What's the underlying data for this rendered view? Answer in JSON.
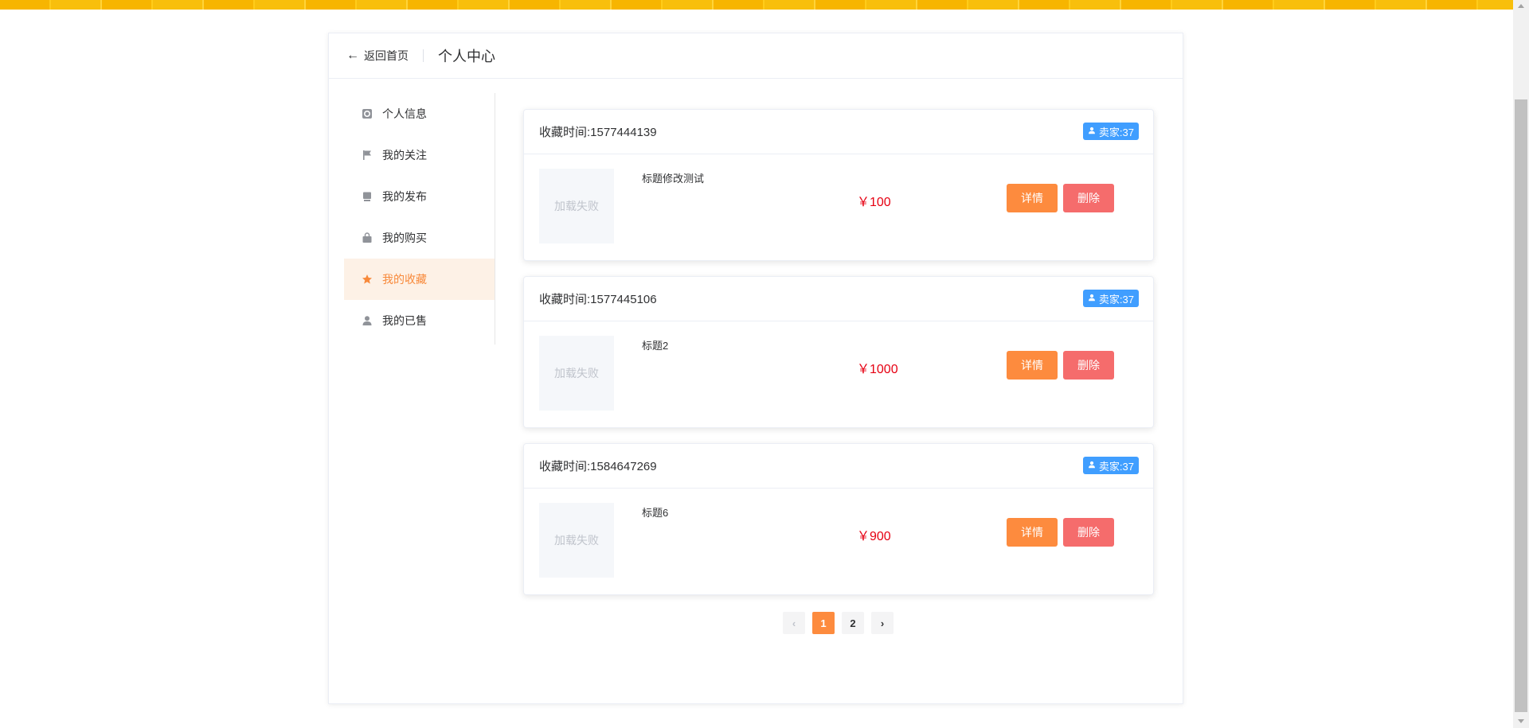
{
  "header": {
    "back_label": "返回首页",
    "title": "个人中心"
  },
  "sidebar": {
    "items": [
      {
        "label": "个人信息",
        "icon": "profile-icon"
      },
      {
        "label": "我的关注",
        "icon": "flag-icon"
      },
      {
        "label": "我的发布",
        "icon": "publish-icon"
      },
      {
        "label": "我的购买",
        "icon": "bag-icon"
      },
      {
        "label": "我的收藏",
        "icon": "star-icon",
        "active": true
      },
      {
        "label": "我的已售",
        "icon": "user-icon"
      }
    ]
  },
  "cards": [
    {
      "time": "收藏时间:1577444139",
      "seller": "卖家:37",
      "image_alt": "加载失败",
      "title": "标题修改测试",
      "price": "￥100",
      "detail": "详情",
      "delete": "删除"
    },
    {
      "time": "收藏时间:1577445106",
      "seller": "卖家:37",
      "image_alt": "加载失败",
      "title": "标题2",
      "price": "￥1000",
      "detail": "详情",
      "delete": "删除"
    },
    {
      "time": "收藏时间:1584647269",
      "seller": "卖家:37",
      "image_alt": "加载失败",
      "title": "标题6",
      "price": "￥900",
      "detail": "详情",
      "delete": "删除"
    }
  ],
  "pagination": {
    "prev": "‹",
    "pages": [
      "1",
      "2"
    ],
    "current": "1",
    "next": "›"
  },
  "colors": {
    "accent": "#fd8b3e",
    "danger": "#f56c6c",
    "price": "#e60012",
    "seller_tag": "#409eff"
  }
}
